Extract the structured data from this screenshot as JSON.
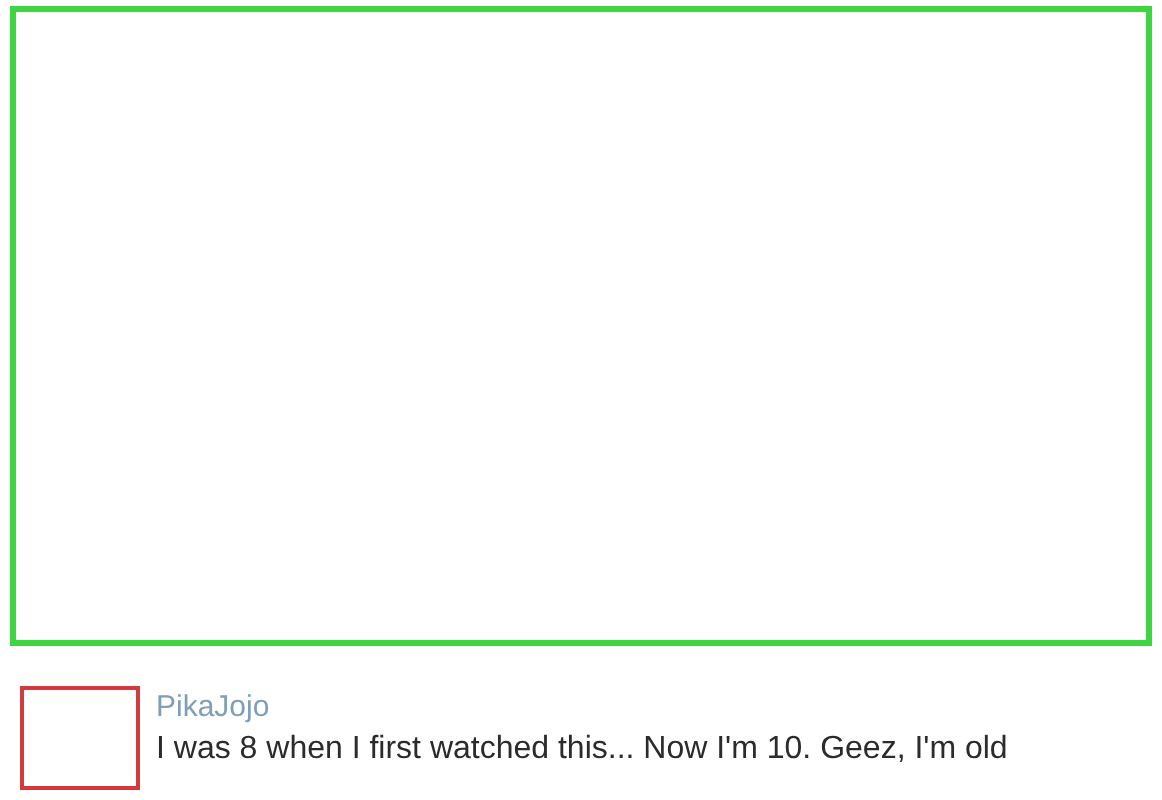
{
  "comment": {
    "author": "PikaJojo",
    "text": "I was 8 when I first watched this... Now I'm 10. Geez, I'm old"
  }
}
